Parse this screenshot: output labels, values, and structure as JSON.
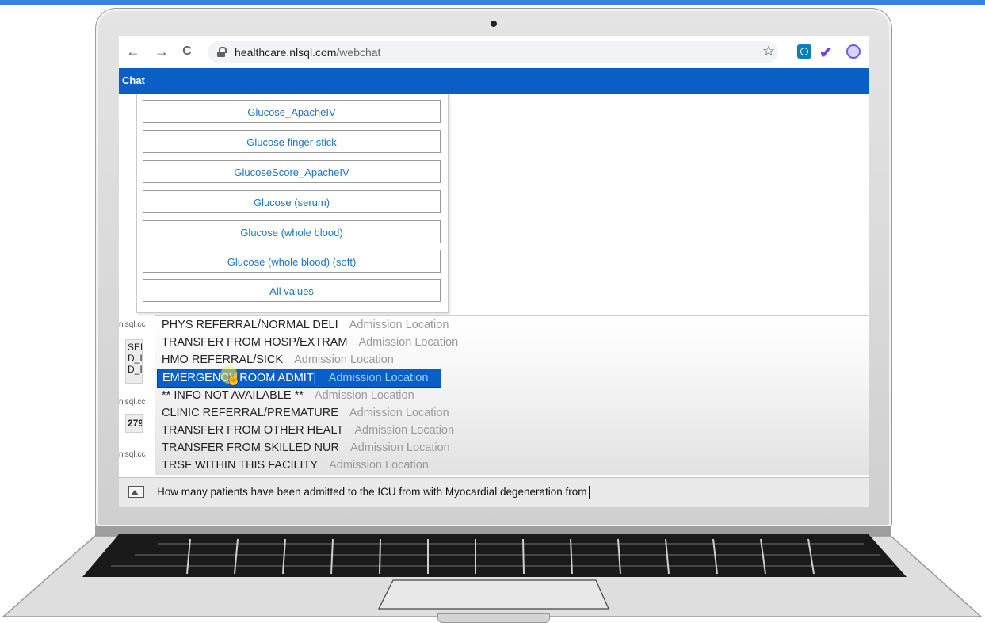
{
  "browser": {
    "url_host": "healthcare.nlsql.com",
    "url_path": "/webchat",
    "back_icon": "←",
    "forward_icon": "→",
    "reload_icon": "C",
    "star_icon": "☆"
  },
  "app": {
    "title": "Chat",
    "accent_color": "#0a5fc7"
  },
  "options": [
    "Glucose_ApacheIV",
    "Glucose finger stick",
    "GlucoseScore_ApacheIV",
    "Glucose (serum)",
    "Glucose (whole blood)",
    "Glucose (whole blood) (soft)",
    "All values"
  ],
  "left_fragments": {
    "label1": "nlsql.cc",
    "code1": "SELE",
    "code2": "D_IT",
    "code3": "D_IT",
    "label2": "nlsql.cc",
    "num": "279",
    "label3": "nlsql.cc"
  },
  "autocomplete": [
    {
      "value": "PHYS REFERRAL/NORMAL DELI",
      "category": "Admission Location"
    },
    {
      "value": "TRANSFER FROM HOSP/EXTRAM",
      "category": "Admission Location"
    },
    {
      "value": "HMO REFERRAL/SICK",
      "category": "Admission Location"
    },
    {
      "value": "EMERGENCY ROOM ADMIT",
      "category": "Admission Location",
      "selected": true
    },
    {
      "value": "** INFO NOT AVAILABLE **",
      "category": "Admission Location"
    },
    {
      "value": "CLINIC REFERRAL/PREMATURE",
      "category": "Admission Location"
    },
    {
      "value": "TRANSFER FROM OTHER HEALT",
      "category": "Admission Location"
    },
    {
      "value": "TRANSFER FROM SKILLED NUR",
      "category": "Admission Location"
    },
    {
      "value": "TRSF WITHIN THIS FACILITY",
      "category": "Admission Location"
    }
  ],
  "input": {
    "value": "How many patients have been admitted to the ICU from with Myocardial degeneration from"
  }
}
